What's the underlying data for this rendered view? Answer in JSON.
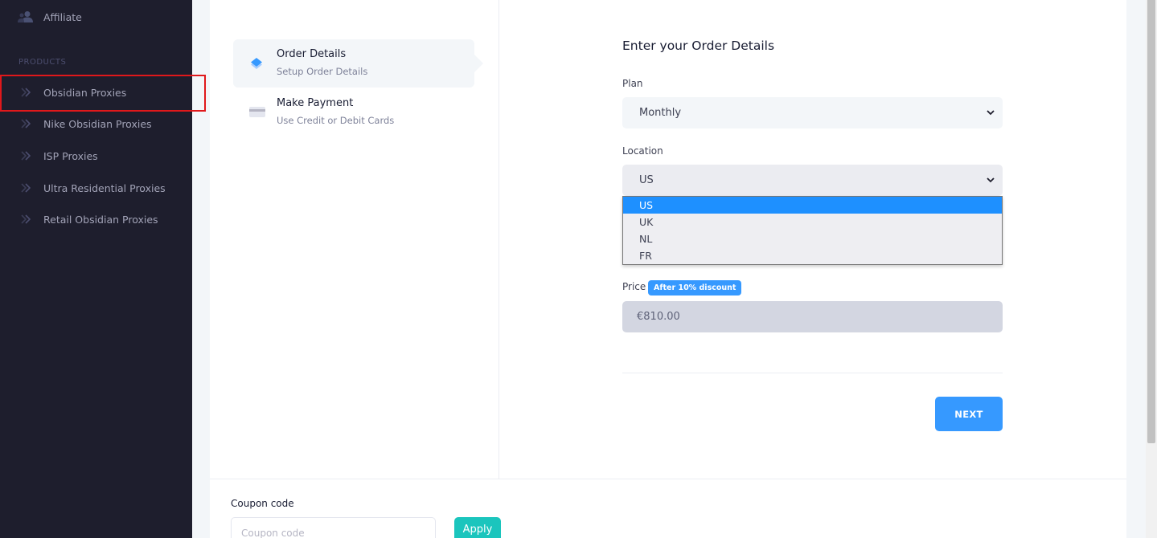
{
  "sidebar": {
    "affiliate_label": "Affiliate",
    "section_title": "PRODUCTS",
    "items": [
      {
        "label": "Obsidian Proxies"
      },
      {
        "label": "Nike Obsidian Proxies"
      },
      {
        "label": "ISP Proxies"
      },
      {
        "label": "Ultra Residential Proxies"
      },
      {
        "label": "Retail Obsidian Proxies"
      }
    ]
  },
  "steps": [
    {
      "title": "Order Details",
      "subtitle": "Setup Order Details",
      "icon": "layers-icon"
    },
    {
      "title": "Make Payment",
      "subtitle": "Use Credit or Debit Cards",
      "icon": "credit-card-icon"
    }
  ],
  "form": {
    "title": "Enter your Order Details",
    "plan_label": "Plan",
    "plan_value": "Monthly",
    "location_label": "Location",
    "location_value": "US",
    "location_options": [
      "US",
      "UK",
      "NL",
      "FR"
    ],
    "price_label": "Price",
    "price_badge": "After 10% discount",
    "price_value": "€810.00",
    "next_label": "NEXT"
  },
  "coupon": {
    "label": "Coupon code",
    "placeholder": "Coupon code",
    "apply_label": "Apply"
  },
  "colors": {
    "sidebar_bg": "#1e1e2d",
    "primary": "#3699ff",
    "success": "#1bc5bd",
    "highlight": "#e0181b"
  }
}
